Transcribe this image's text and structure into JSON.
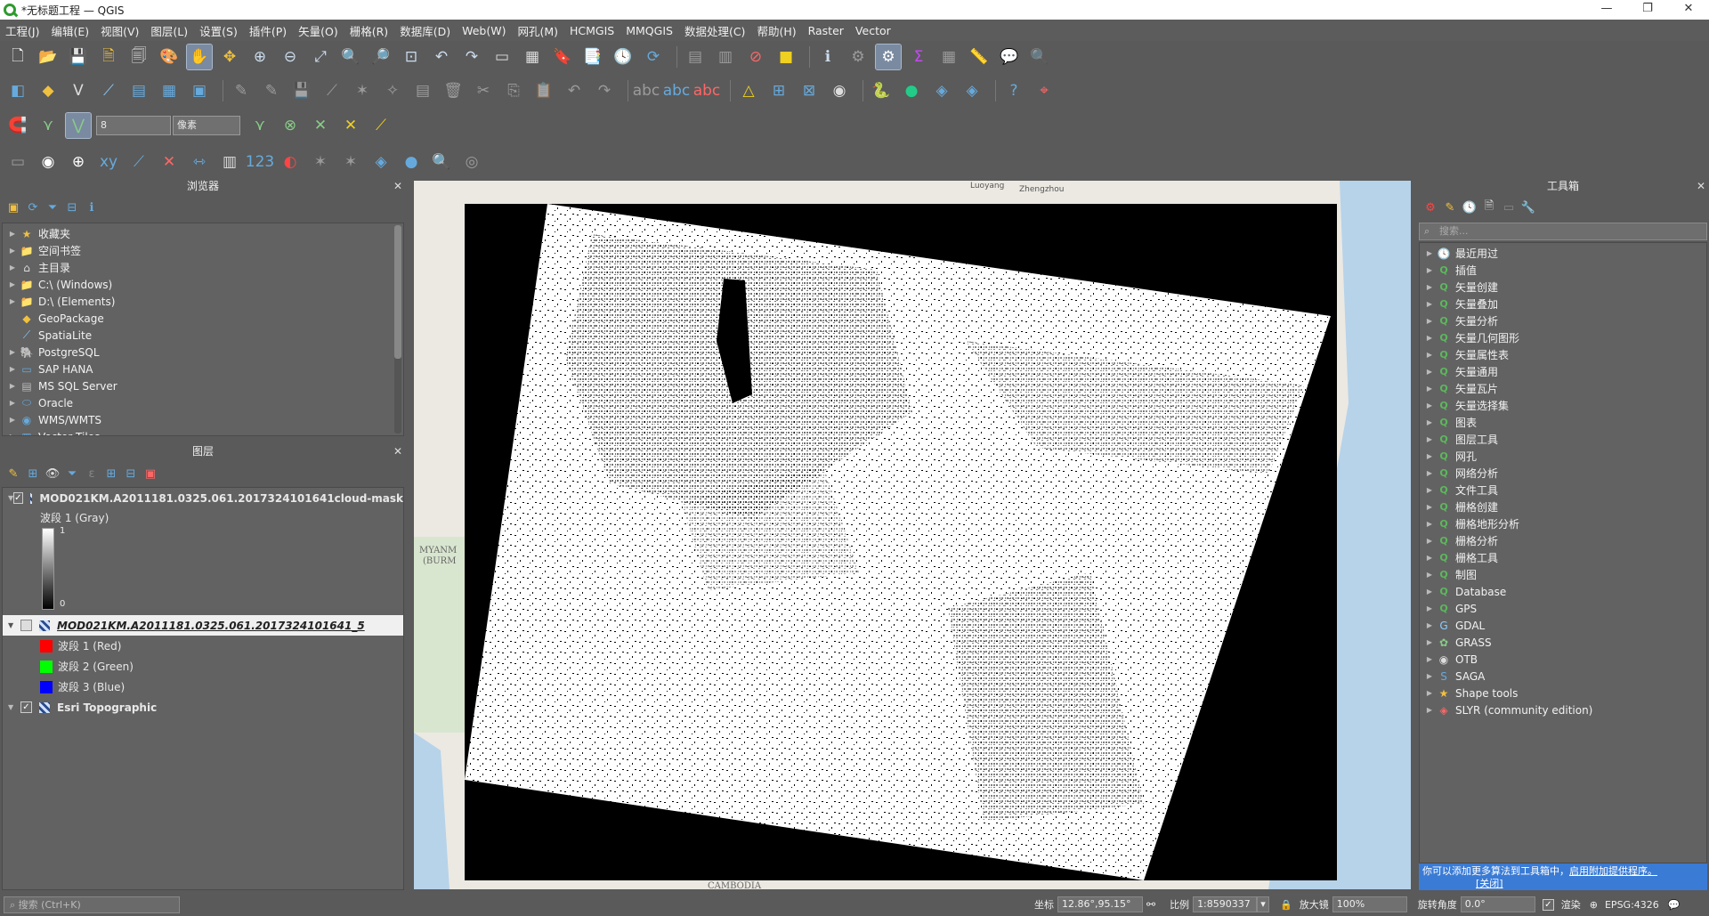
{
  "window": {
    "title": "*无标题工程 — QGIS",
    "controls": [
      "—",
      "❐",
      "✕"
    ]
  },
  "menu": [
    "工程(J)",
    "编辑(E)",
    "视图(V)",
    "图层(L)",
    "设置(S)",
    "插件(P)",
    "矢量(O)",
    "栅格(R)",
    "数据库(D)",
    "Web(W)",
    "网孔(M)",
    "HCMGIS",
    "MMQGIS",
    "数据处理(C)",
    "帮助(H)",
    "Raster",
    "Vector"
  ],
  "snapping": {
    "tolerance": "8",
    "units": "像素"
  },
  "browser": {
    "title": "浏览器",
    "items": [
      {
        "label": "收藏夹",
        "icon": "star-icon"
      },
      {
        "label": "空间书签",
        "icon": "folder-icon"
      },
      {
        "label": "主目录",
        "icon": "home-icon"
      },
      {
        "label": "C:\\ (Windows)",
        "icon": "folder-icon"
      },
      {
        "label": "D:\\ (Elements)",
        "icon": "folder-icon"
      },
      {
        "label": "GeoPackage",
        "icon": "geopackage-icon"
      },
      {
        "label": "SpatiaLite",
        "icon": "spatialite-icon"
      },
      {
        "label": "PostgreSQL",
        "icon": "postgresql-icon"
      },
      {
        "label": "SAP HANA",
        "icon": "saphana-icon"
      },
      {
        "label": "MS SQL Server",
        "icon": "mssql-icon"
      },
      {
        "label": "Oracle",
        "icon": "oracle-icon"
      },
      {
        "label": "WMS/WMTS",
        "icon": "wms-icon"
      },
      {
        "label": "Vector Tiles",
        "icon": "vectortiles-icon"
      }
    ]
  },
  "layers": {
    "title": "图层",
    "cloud_mask": {
      "name": "MOD021KM.A2011181.0325.061.2017324101641cloud-mask",
      "band": "波段 1 (Gray)",
      "max": "1",
      "min": "0"
    },
    "rgb": {
      "name": "MOD021KM.A2011181.0325.061.2017324101641_5",
      "bands": [
        {
          "label": "波段 1 (Red)",
          "color": "#ff0000"
        },
        {
          "label": "波段 2 (Green)",
          "color": "#00ff00"
        },
        {
          "label": "波段 3 (Blue)",
          "color": "#0000ff"
        }
      ]
    },
    "basemap": {
      "name": "Esri Topographic"
    }
  },
  "map": {
    "labels": {
      "luoyang": "Luoyang",
      "zhengzhou": "Zhengzhou",
      "myanmar": "MYANM",
      "burma": "(BURM",
      "cambodia": "CAMBODIA"
    }
  },
  "toolbox": {
    "title": "工具箱",
    "search_placeholder": "搜索...",
    "items": [
      {
        "label": "最近用过",
        "icon": "clock-icon"
      },
      {
        "label": "插值",
        "icon": "qgis-icon"
      },
      {
        "label": "矢量创建",
        "icon": "qgis-icon"
      },
      {
        "label": "矢量叠加",
        "icon": "qgis-icon"
      },
      {
        "label": "矢量分析",
        "icon": "qgis-icon"
      },
      {
        "label": "矢量几何图形",
        "icon": "qgis-icon"
      },
      {
        "label": "矢量属性表",
        "icon": "qgis-icon"
      },
      {
        "label": "矢量通用",
        "icon": "qgis-icon"
      },
      {
        "label": "矢量瓦片",
        "icon": "qgis-icon"
      },
      {
        "label": "矢量选择集",
        "icon": "qgis-icon"
      },
      {
        "label": "图表",
        "icon": "qgis-icon"
      },
      {
        "label": "图层工具",
        "icon": "qgis-icon"
      },
      {
        "label": "网孔",
        "icon": "qgis-icon"
      },
      {
        "label": "网络分析",
        "icon": "qgis-icon"
      },
      {
        "label": "文件工具",
        "icon": "qgis-icon"
      },
      {
        "label": "栅格创建",
        "icon": "qgis-icon"
      },
      {
        "label": "栅格地形分析",
        "icon": "qgis-icon"
      },
      {
        "label": "栅格分析",
        "icon": "qgis-icon"
      },
      {
        "label": "栅格工具",
        "icon": "qgis-icon"
      },
      {
        "label": "制图",
        "icon": "qgis-icon"
      },
      {
        "label": "Database",
        "icon": "qgis-icon"
      },
      {
        "label": "GPS",
        "icon": "qgis-icon"
      },
      {
        "label": "GDAL",
        "icon": "gdal-icon"
      },
      {
        "label": "GRASS",
        "icon": "grass-icon"
      },
      {
        "label": "OTB",
        "icon": "otb-icon"
      },
      {
        "label": "SAGA",
        "icon": "saga-icon"
      },
      {
        "label": "Shape tools",
        "icon": "star-icon"
      },
      {
        "label": "SLYR (community edition)",
        "icon": "slyr-icon"
      }
    ],
    "notice_text": "你可以添加更多算法到工具箱中，",
    "notice_link": "启用附加提供程序。",
    "notice_close": "[关闭]"
  },
  "statusbar": {
    "search_placeholder": "搜索 (Ctrl+K)",
    "coord_label": "坐标",
    "coord_value": "12.86°,95.15°",
    "scale_label": "比例",
    "scale_value": "1:8590337",
    "magnifier_label": "放大镜",
    "magnifier_value": "100%",
    "rotation_label": "旋转角度",
    "rotation_value": "0.0°",
    "render_label": "渲染",
    "crs": "EPSG:4326"
  },
  "colors": {
    "panel_bg": "#626262",
    "chrome_bg": "#5a5a5a",
    "link": "#ffffff",
    "notice_bg": "#3a7bd5",
    "water": "#b6d3ea"
  }
}
